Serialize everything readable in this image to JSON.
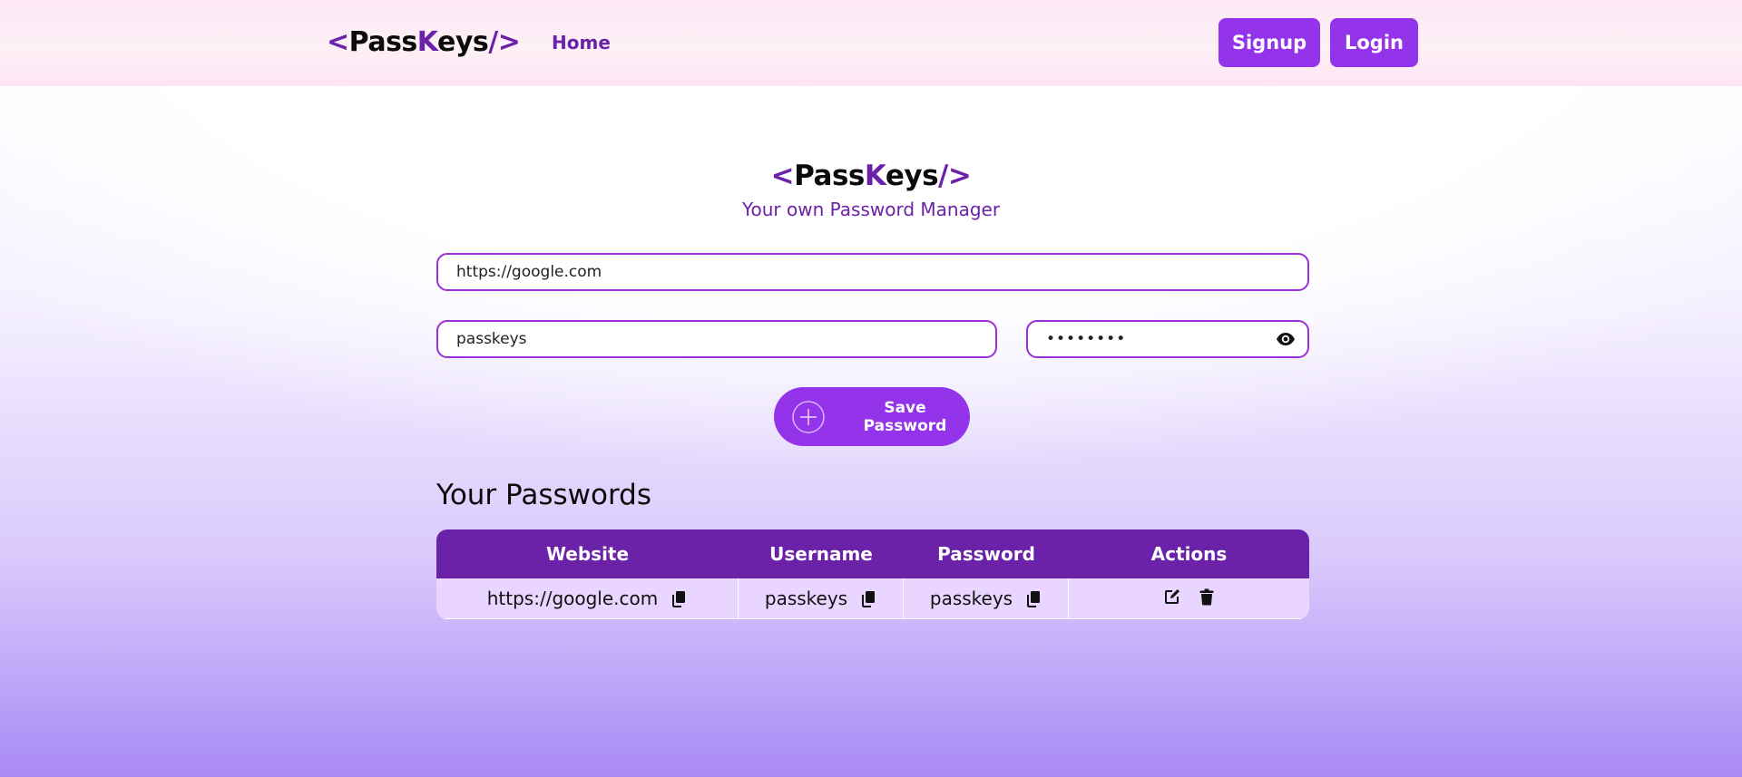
{
  "brand": {
    "open_bracket": "<",
    "pass": "Pass",
    "k": "K",
    "eys": "eys",
    "close_bracket": "/>"
  },
  "nav": {
    "home": "Home",
    "signup": "Signup",
    "login": "Login"
  },
  "hero": {
    "subtitle": "Your own Password Manager"
  },
  "form": {
    "website_value": "https://google.com",
    "username_value": "passkeys",
    "password_value": "••••••••",
    "save_label": "Save Password"
  },
  "passwords": {
    "heading": "Your Passwords",
    "columns": [
      "Website",
      "Username",
      "Password",
      "Actions"
    ],
    "rows": [
      {
        "website": "https://google.com",
        "username": "passkeys",
        "password": "passkeys"
      }
    ]
  },
  "icons": {
    "eye": "eye-icon",
    "plus": "plus-circle-icon",
    "copy": "copy-icon",
    "edit": "edit-icon",
    "delete": "trash-icon"
  },
  "colors": {
    "accent": "#9333ea",
    "brand_dark": "#6b21a8",
    "row_bg": "#e9d5ff",
    "nav_bg": "#fde8f3"
  }
}
